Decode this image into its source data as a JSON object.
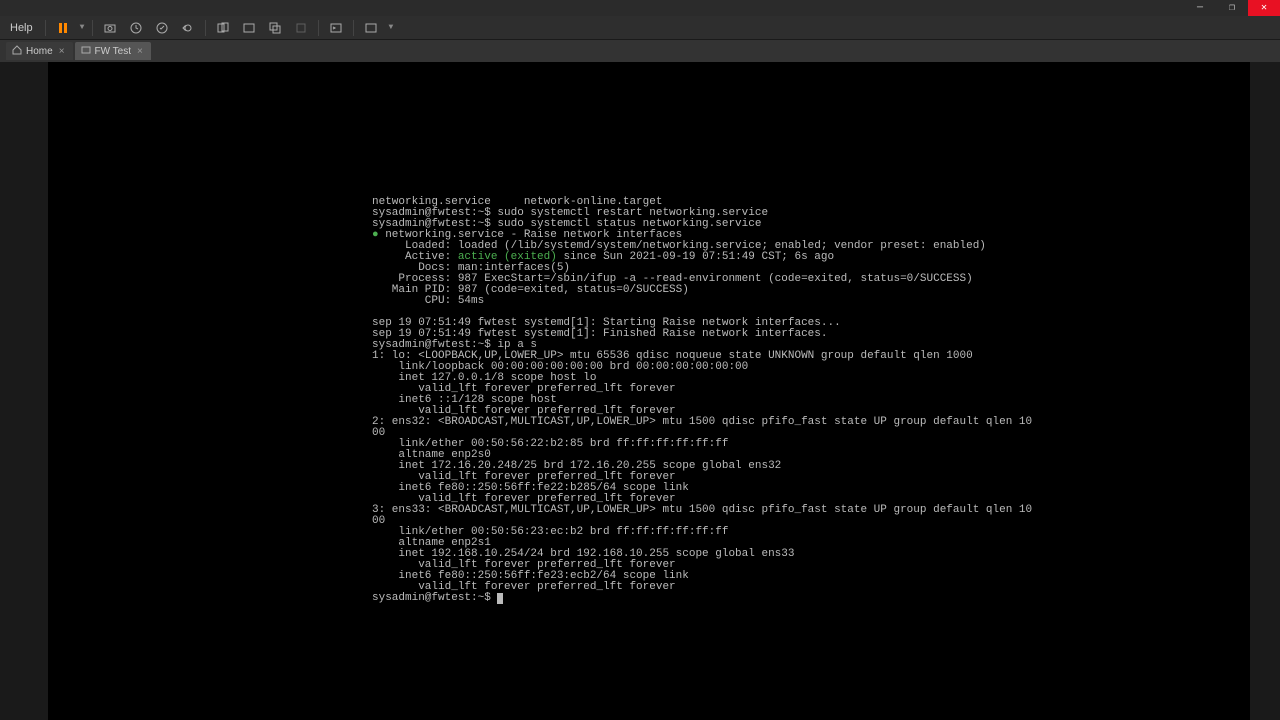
{
  "menu": {
    "help": "Help"
  },
  "tabs": [
    {
      "label": "Home"
    },
    {
      "label": "FW Test"
    }
  ],
  "term": {
    "l01": "networking.service     network-online.target",
    "l02": "sysadmin@fwtest:~$ sudo systemctl restart networking.service",
    "l03": "sysadmin@fwtest:~$ sudo systemctl status networking.service",
    "l04a": "● ",
    "l04b": "networking.service - Raise network interfaces",
    "l05": "     Loaded: loaded (/lib/systemd/system/networking.service; enabled; vendor preset: enabled)",
    "l06a": "     Active: ",
    "l06b": "active (exited)",
    "l06c": " since Sun 2021-09-19 07:51:49 CST; 6s ago",
    "l07": "       Docs: man:interfaces(5)",
    "l08": "    Process: 987 ExecStart=/sbin/ifup -a --read-environment (code=exited, status=0/SUCCESS)",
    "l09": "   Main PID: 987 (code=exited, status=0/SUCCESS)",
    "l10": "        CPU: 54ms",
    "l11": "",
    "l12": "sep 19 07:51:49 fwtest systemd[1]: Starting Raise network interfaces...",
    "l13": "sep 19 07:51:49 fwtest systemd[1]: Finished Raise network interfaces.",
    "l14": "sysadmin@fwtest:~$ ip a s",
    "l15": "1: lo: <LOOPBACK,UP,LOWER_UP> mtu 65536 qdisc noqueue state UNKNOWN group default qlen 1000",
    "l16": "    link/loopback 00:00:00:00:00:00 brd 00:00:00:00:00:00",
    "l17": "    inet 127.0.0.1/8 scope host lo",
    "l18": "       valid_lft forever preferred_lft forever",
    "l19": "    inet6 ::1/128 scope host",
    "l20": "       valid_lft forever preferred_lft forever",
    "l21": "2: ens32: <BROADCAST,MULTICAST,UP,LOWER_UP> mtu 1500 qdisc pfifo_fast state UP group default qlen 10",
    "l21b": "00",
    "l22": "    link/ether 00:50:56:22:b2:85 brd ff:ff:ff:ff:ff:ff",
    "l23": "    altname enp2s0",
    "l24": "    inet 172.16.20.248/25 brd 172.16.20.255 scope global ens32",
    "l25": "       valid_lft forever preferred_lft forever",
    "l26": "    inet6 fe80::250:56ff:fe22:b285/64 scope link",
    "l27": "       valid_lft forever preferred_lft forever",
    "l28": "3: ens33: <BROADCAST,MULTICAST,UP,LOWER_UP> mtu 1500 qdisc pfifo_fast state UP group default qlen 10",
    "l28b": "00",
    "l29": "    link/ether 00:50:56:23:ec:b2 brd ff:ff:ff:ff:ff:ff",
    "l30": "    altname enp2s1",
    "l31": "    inet 192.168.10.254/24 brd 192.168.10.255 scope global ens33",
    "l32": "       valid_lft forever preferred_lft forever",
    "l33": "    inet6 fe80::250:56ff:fe23:ecb2/64 scope link",
    "l34": "       valid_lft forever preferred_lft forever",
    "l35": "sysadmin@fwtest:~$ "
  }
}
